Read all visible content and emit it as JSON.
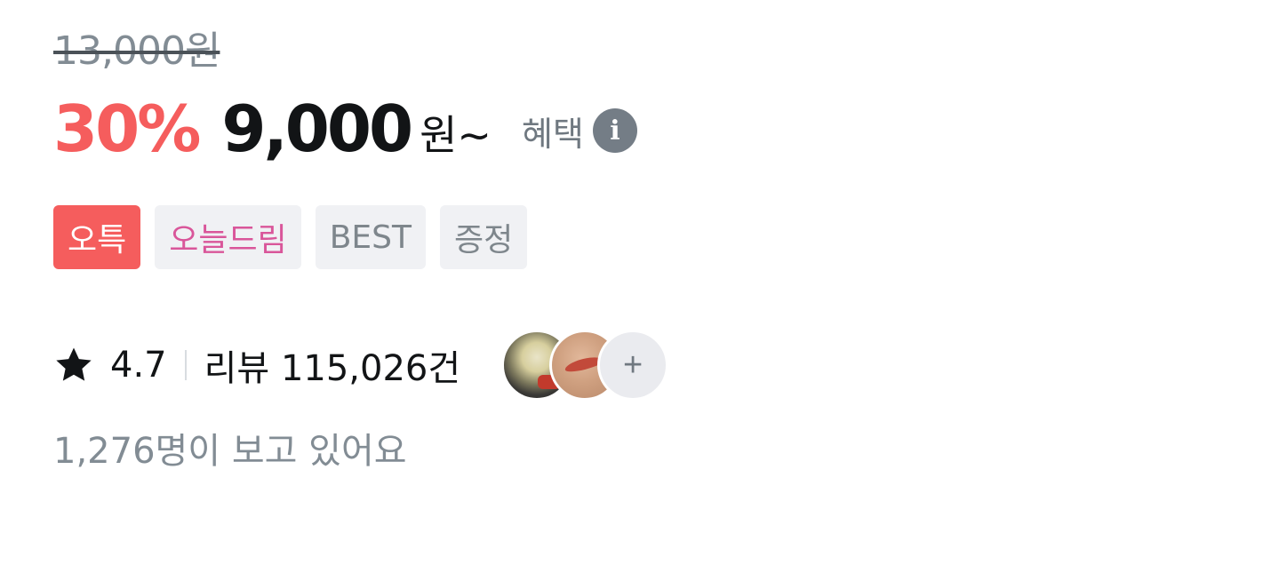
{
  "price": {
    "original": "13,000원",
    "discount_rate": "30%",
    "sale_price": "9,000",
    "currency_suffix": "원~",
    "benefit_label": "혜택",
    "info_icon_glyph": "i"
  },
  "badges": [
    "오특",
    "오늘드림",
    "BEST",
    "증정"
  ],
  "rating": {
    "star_icon": "star-icon",
    "score": "4.7",
    "review_label": "리뷰 115,026건",
    "more_glyph": "+"
  },
  "viewers_text": "1,276명이 보고 있어요",
  "colors": {
    "discount": "#f55d5d",
    "primary_badge": "#f55d5d",
    "pink_badge_text": "#d9569a",
    "muted_text": "#828c94",
    "dark_text": "#121416"
  }
}
